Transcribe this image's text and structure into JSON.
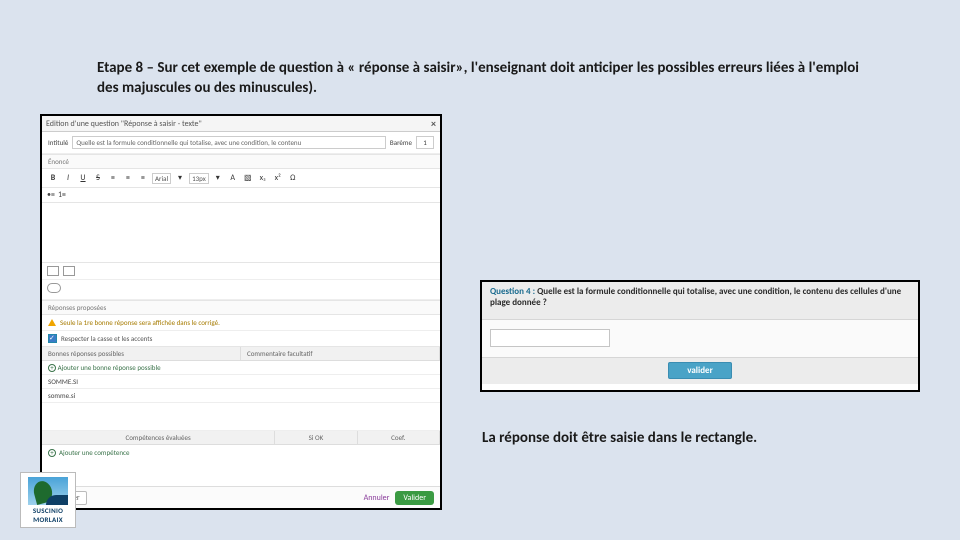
{
  "heading": "Etape 8 – Sur cet exemple de question à « réponse à saisir», l'enseignant doit anticiper les possibles erreurs liées à l'emploi des majuscules ou des minuscules).",
  "caption": "La réponse doit être saisie dans le rectangle.",
  "editor": {
    "title": "Edition d'une question \"Réponse à saisir - texte\"",
    "intitule_label": "Intitulé",
    "intitule_value": "Quelle est la formule conditionnelle qui totalise, avec une condition, le contenu",
    "bareme_label": "Barème",
    "bareme_value": "1",
    "enonce_label": "Énoncé",
    "font_name": "Arial",
    "font_size": "13px",
    "reponses_label": "Réponses proposées",
    "info_text": "Seule la 1re bonne réponse sera affichée dans le corrigé.",
    "respect_text": "Respecter la casse et les accents",
    "col_bonnes": "Bonnes réponses possibles",
    "col_comment": "Commentaire facultatif",
    "add_answer": "Ajouter une bonne réponse possible",
    "answer1": "SOMME.SI",
    "answer2": "somme.si",
    "comp_col1": "Compétences évaluées",
    "comp_col2": "Si OK",
    "comp_col3": "Coef.",
    "add_comp": "Ajouter une compétence",
    "btn_sim": "Simuler",
    "btn_ann": "Annuler",
    "btn_val": "Valider"
  },
  "preview": {
    "qnum": "Question 4 :",
    "qtext": "Quelle est la formule conditionnelle qui totalise, avec une condition, le contenu des cellules d'une plage donnée ?",
    "valider": "valider"
  },
  "logo": {
    "line1": "SUSCINIO",
    "line2": "MORLAIX"
  }
}
